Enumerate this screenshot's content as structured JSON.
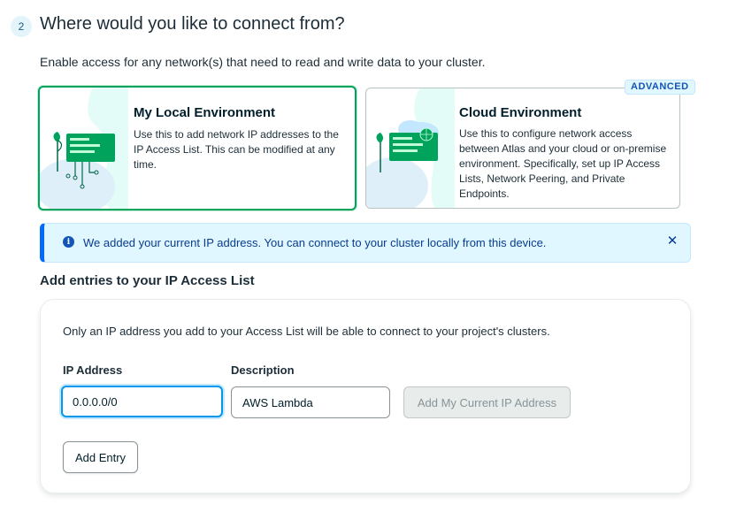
{
  "step": {
    "number": "2",
    "title": "Where would you like to connect from?"
  },
  "intro_text": "Enable access for any network(s) that need to read and write data to your cluster.",
  "environments": {
    "local": {
      "title": "My Local Environment",
      "description": "Use this to add network IP addresses to the IP Access List. This can be modified at any time.",
      "selected": true
    },
    "cloud": {
      "title": "Cloud Environment",
      "description": "Use this to configure network access between Atlas and your cloud or on-premise environment. Specifically, set up IP Access Lists, Network Peering, and Private Endpoints.",
      "badge": "ADVANCED",
      "selected": false
    }
  },
  "banner": {
    "icon": "info-icon",
    "text": "We added your current IP address. You can connect to your cluster locally from this device.",
    "close_icon": "close-icon"
  },
  "access_list": {
    "heading": "Add entries to your IP Access List",
    "note": "Only an IP address you add to your Access List will be able to connect to your project's clusters.",
    "ip_label": "IP Address",
    "ip_value": "0.0.0.0/0",
    "description_label": "Description",
    "description_value": "AWS Lambda",
    "add_current_ip_label": "Add My Current IP Address",
    "add_entry_label": "Add Entry"
  },
  "colors": {
    "accent_green": "#00a35c",
    "info_blue": "#016bf8",
    "banner_bg": "#e1f7ff",
    "focus_blue": "#0498ec"
  }
}
